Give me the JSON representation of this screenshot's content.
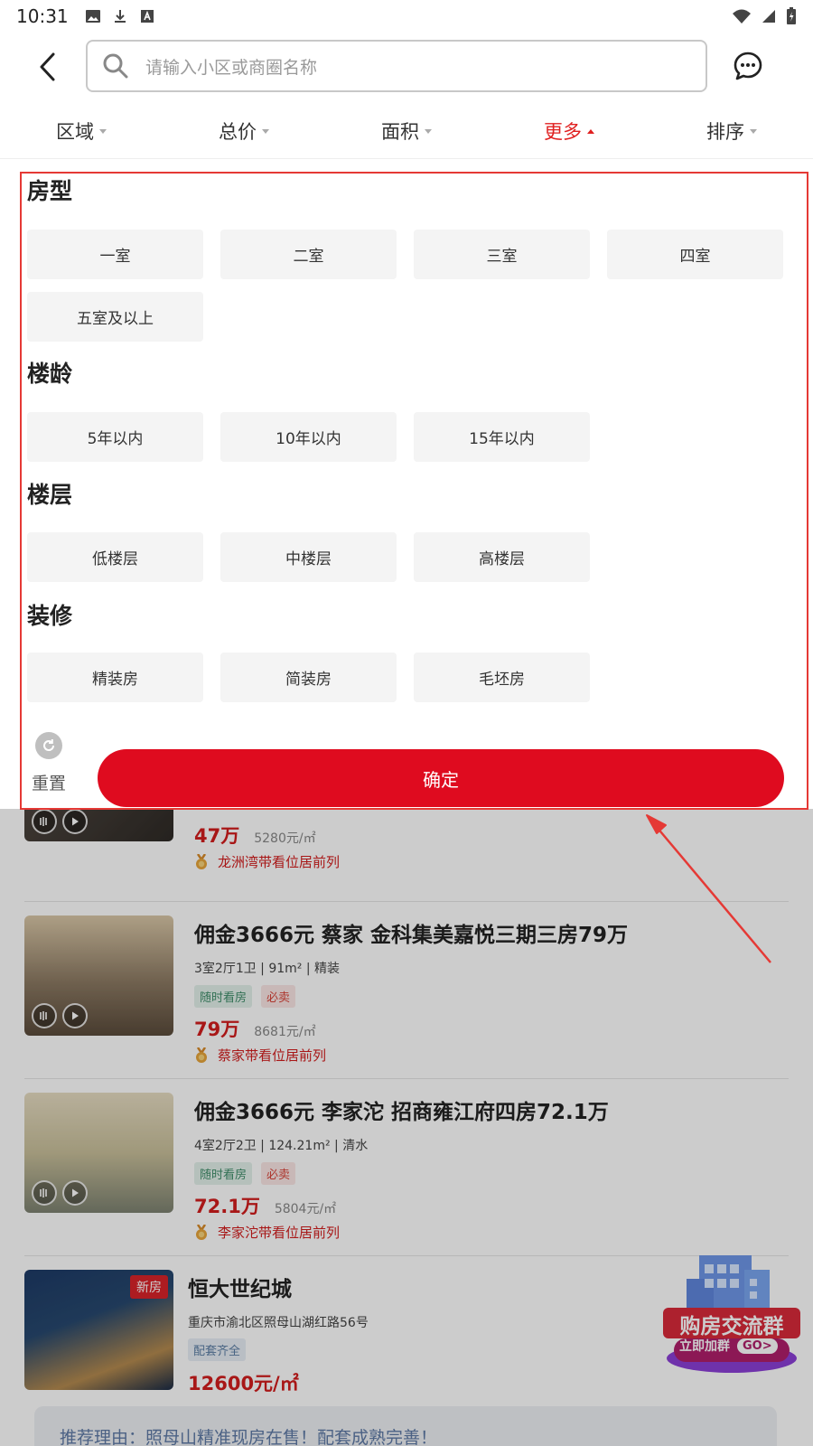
{
  "status_bar": {
    "time": "10:31"
  },
  "search": {
    "placeholder": "请输入小区或商圈名称"
  },
  "filter_tabs": [
    {
      "label": "区域",
      "active": false
    },
    {
      "label": "总价",
      "active": false
    },
    {
      "label": "面积",
      "active": false
    },
    {
      "label": "更多",
      "active": true
    },
    {
      "label": "排序",
      "active": false
    }
  ],
  "panel": {
    "sections": [
      {
        "title": "房型",
        "options": [
          "一室",
          "二室",
          "三室",
          "四室",
          "五室及以上"
        ]
      },
      {
        "title": "楼龄",
        "options": [
          "5年以内",
          "10年以内",
          "15年以内"
        ]
      },
      {
        "title": "楼层",
        "options": [
          "低楼层",
          "中楼层",
          "高楼层"
        ]
      },
      {
        "title": "装修",
        "options": [
          "精装房",
          "简装房",
          "毛坯房"
        ]
      }
    ],
    "reset_label": "重置",
    "confirm_label": "确定"
  },
  "listings": [
    {
      "price": "47万",
      "unit_price": "5280元/㎡",
      "agent_note": "龙洲湾带看位居前列"
    },
    {
      "title": "佣金3666元 蔡家 金科集美嘉悦三期三房79万",
      "attrs": "3室2厅1卫 | 91m² | 精装",
      "tags": [
        "随时看房",
        "必卖"
      ],
      "price": "79万",
      "unit_price": "8681元/㎡",
      "agent_note": "蔡家带看位居前列"
    },
    {
      "title": "佣金3666元 李家沱 招商雍江府四房72.1万",
      "attrs": "4室2厅2卫 | 124.21m² | 清水",
      "tags": [
        "随时看房",
        "必卖"
      ],
      "price": "72.1万",
      "unit_price": "5804元/㎡",
      "agent_note": "李家沱带看位居前列"
    },
    {
      "badge": "新房",
      "title": "恒大世纪城",
      "address": "重庆市渝北区照母山湖红路56号",
      "tags": [
        "配套齐全"
      ],
      "price": "12600元/㎡"
    }
  ],
  "recommend_reason": "推荐理由：照母山精准现房在售！配套成熟完善！",
  "promo": {
    "title": "购房交流群",
    "cta": "立即加群",
    "go": "GO>"
  },
  "colors": {
    "accent": "#df0b1f",
    "annotation": "#e53935"
  }
}
